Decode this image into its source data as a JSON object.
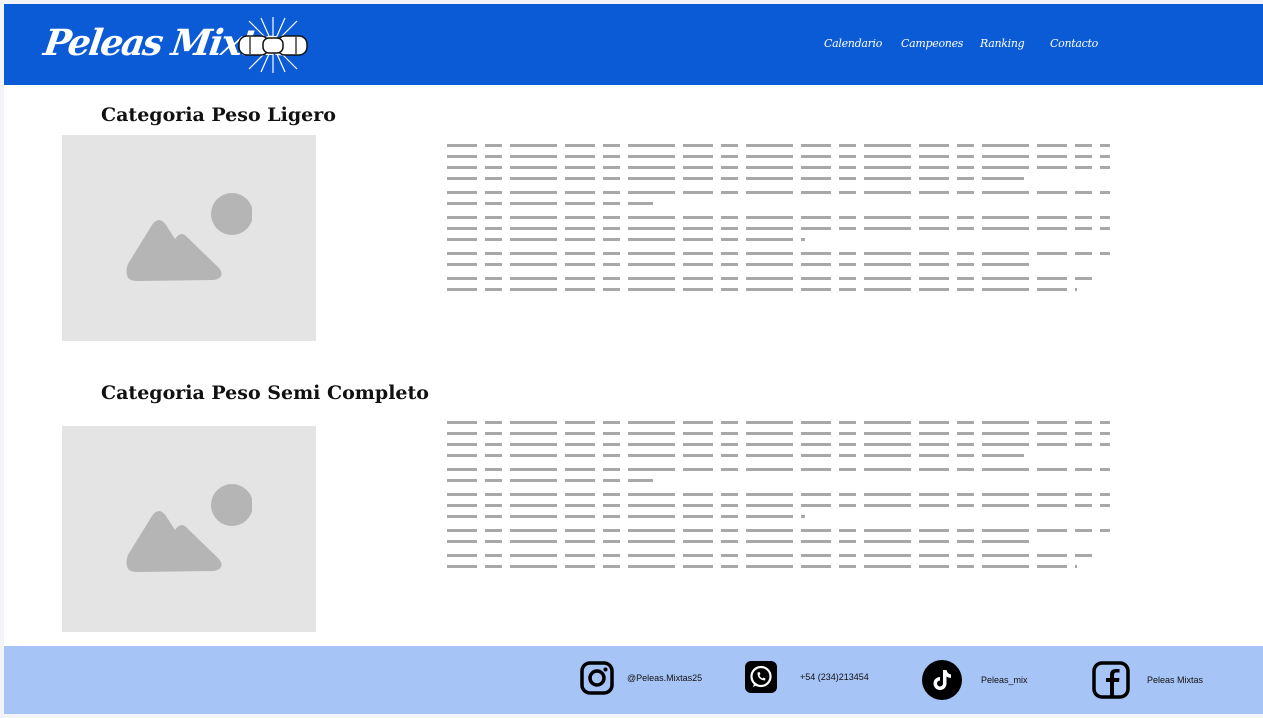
{
  "header": {
    "brand": "Peleas Mixtas",
    "nav": [
      {
        "label": "Calendario"
      },
      {
        "label": "Campeones"
      },
      {
        "label": "Ranking"
      },
      {
        "label": "Contacto"
      }
    ]
  },
  "sections": [
    {
      "title": "Categoria Peso Ligero"
    },
    {
      "title": "Categoria Peso Semi Completo"
    }
  ],
  "footer": {
    "instagram": "@Peleas.Mixtas25",
    "whatsapp": "+54 (234)213454",
    "tiktok": "Peleas_mix",
    "facebook": "Peleas Mixtas"
  },
  "colors": {
    "header_bg": "#0b5ad6",
    "footer_bg": "#a7c4f6",
    "placeholder_bg": "#e4e4e4"
  }
}
